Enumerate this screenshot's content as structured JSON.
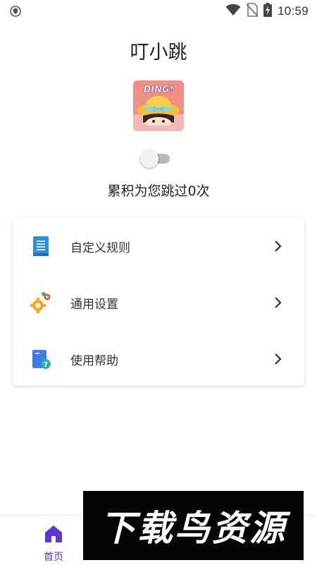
{
  "status_bar": {
    "time": "10:59",
    "left_icon": "vpn-shield-icon",
    "right_icons": [
      "wifi-icon",
      "no-sim-icon",
      "battery-charging-icon"
    ]
  },
  "app": {
    "title": "叮小跳",
    "logo_text": "DING!"
  },
  "toggle": {
    "state": "off"
  },
  "summary": {
    "text": "累积为您跳过0次"
  },
  "menu": {
    "items": [
      {
        "label": "自定义规则",
        "icon": "document-list-icon"
      },
      {
        "label": "通用设置",
        "icon": "gears-icon"
      },
      {
        "label": "使用帮助",
        "icon": "help-book-icon"
      }
    ]
  },
  "bottom_nav": {
    "items": [
      {
        "label": "首页",
        "icon": "home-icon",
        "active": true
      }
    ]
  },
  "watermark": {
    "text": "下载鸟资源"
  },
  "colors": {
    "accent": "#5b35d6",
    "text": "#222222",
    "card_bg": "#ffffff",
    "watermark_bg": "#050505"
  }
}
